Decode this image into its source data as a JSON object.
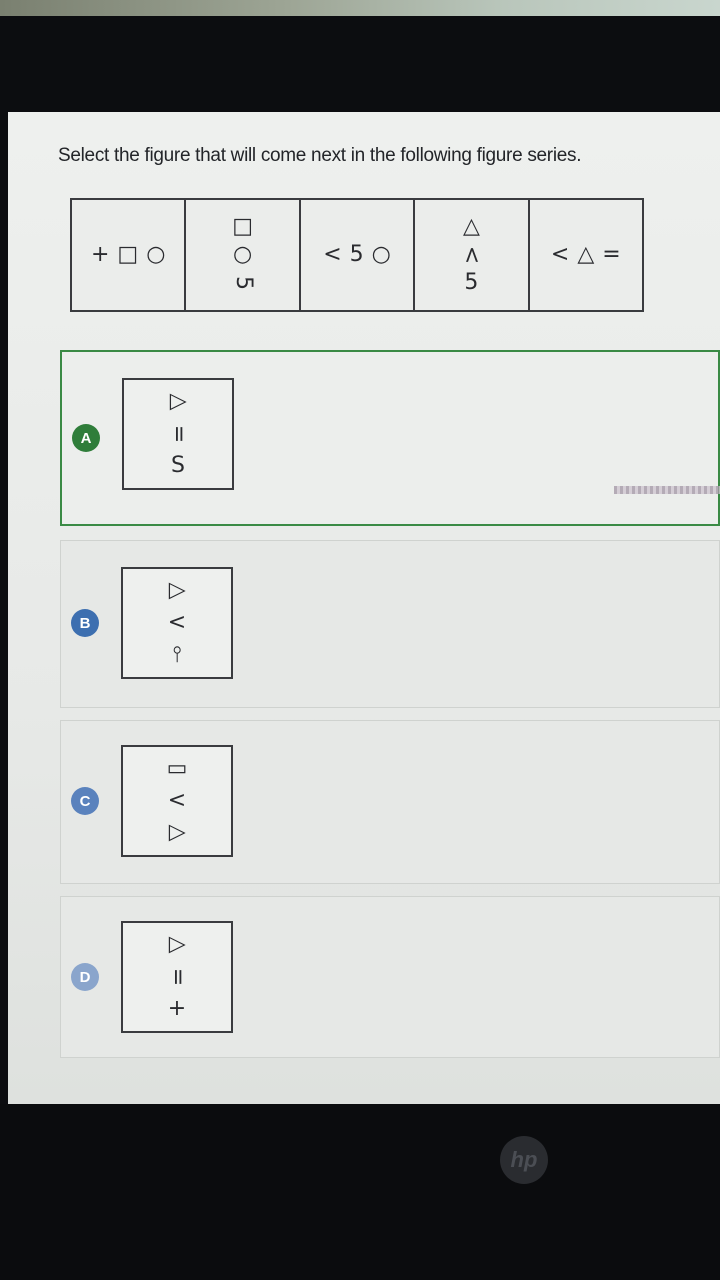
{
  "question": {
    "title": "Select the figure that will come next in the following figure series."
  },
  "series": [
    {
      "layout": "row",
      "symbols": [
        "+",
        "□",
        "○"
      ]
    },
    {
      "layout": "col",
      "symbols": [
        "□",
        "○",
        "5"
      ]
    },
    {
      "layout": "row",
      "symbols": [
        "<",
        "5",
        "○"
      ]
    },
    {
      "layout": "col",
      "symbols": [
        "△",
        "<",
        "5"
      ]
    },
    {
      "layout": "row",
      "symbols": [
        "<",
        "△",
        "="
      ]
    }
  ],
  "options": [
    {
      "letter": "A",
      "symbols": [
        "△",
        "=",
        "S"
      ],
      "selected": true,
      "color": "#2f7d3a"
    },
    {
      "letter": "B",
      "symbols": [
        "△",
        "<",
        "⫯"
      ],
      "selected": false,
      "color": "#3d6fb0"
    },
    {
      "letter": "C",
      "symbols": [
        "▭",
        "<",
        "△"
      ],
      "selected": false,
      "color": "#5a82bd"
    },
    {
      "letter": "D",
      "symbols": [
        "△",
        "=",
        "+"
      ],
      "selected": false,
      "color": "#8aa5cc"
    }
  ],
  "device": {
    "brand": "hp"
  }
}
